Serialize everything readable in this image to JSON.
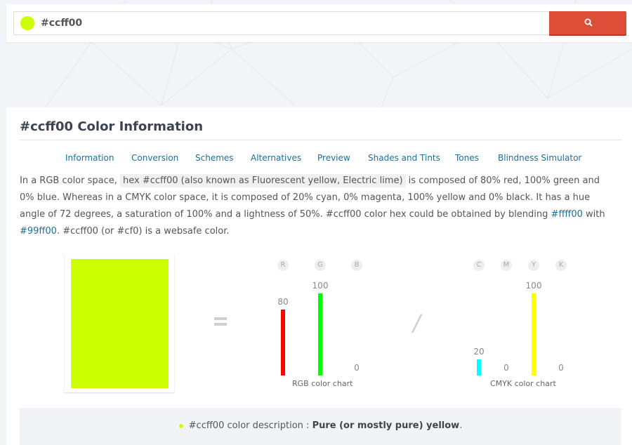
{
  "search": {
    "value": "#ccff00",
    "swatch_color": "#ccff00",
    "button_icon": "search-icon",
    "button_color": "#dc4e38"
  },
  "page": {
    "title": "#ccff00 Color Information",
    "tabs": [
      "Information",
      "Conversion",
      "Schemes",
      "Alternatives",
      "Preview",
      "Shades and Tints",
      "Tones",
      "Blindness Simulator"
    ]
  },
  "description": {
    "p1": "In a RGB color space,",
    "code": "hex #ccff00 (also known as Fluorescent yellow, Electric lime)",
    "p2": "is composed of 80% red, 100% green and 0% blue. Whereas in a CMYK color space, it is composed of 20% cyan, 0% magenta, 100% yellow and 0% black. It has a hue angle of 72 degrees, a saturation of 100% and a lightness of 50%. #ccff00 color hex could be obtained by blending",
    "link1": "#ffff00",
    "p3": "with",
    "link2": "#99ff00",
    "p4": ". #ccff00 (or #cf0) is a websafe color."
  },
  "swatch": {
    "color": "#ccff00"
  },
  "rgb_chart": {
    "caption": "RGB color chart",
    "letters": [
      "R",
      "G",
      "B"
    ],
    "values": [
      80,
      100,
      0
    ],
    "labels": [
      "80",
      "100",
      "0"
    ],
    "colors": [
      "#ff0000",
      "#00ff00",
      "#0000ff"
    ]
  },
  "cmyk_chart": {
    "caption": "CMYK color chart",
    "letters": [
      "C",
      "M",
      "Y",
      "K"
    ],
    "values": [
      20,
      0,
      100,
      0
    ],
    "labels": [
      "20",
      "0",
      "100",
      "0"
    ],
    "colors": [
      "#00ffff",
      "#ff00ff",
      "#ffff00",
      "#000000"
    ]
  },
  "footer": {
    "prefix": "#ccff00 color description :",
    "value": "Pure (or mostly pure) yellow",
    "suffix": ".",
    "dot_color": "#ccff00"
  }
}
